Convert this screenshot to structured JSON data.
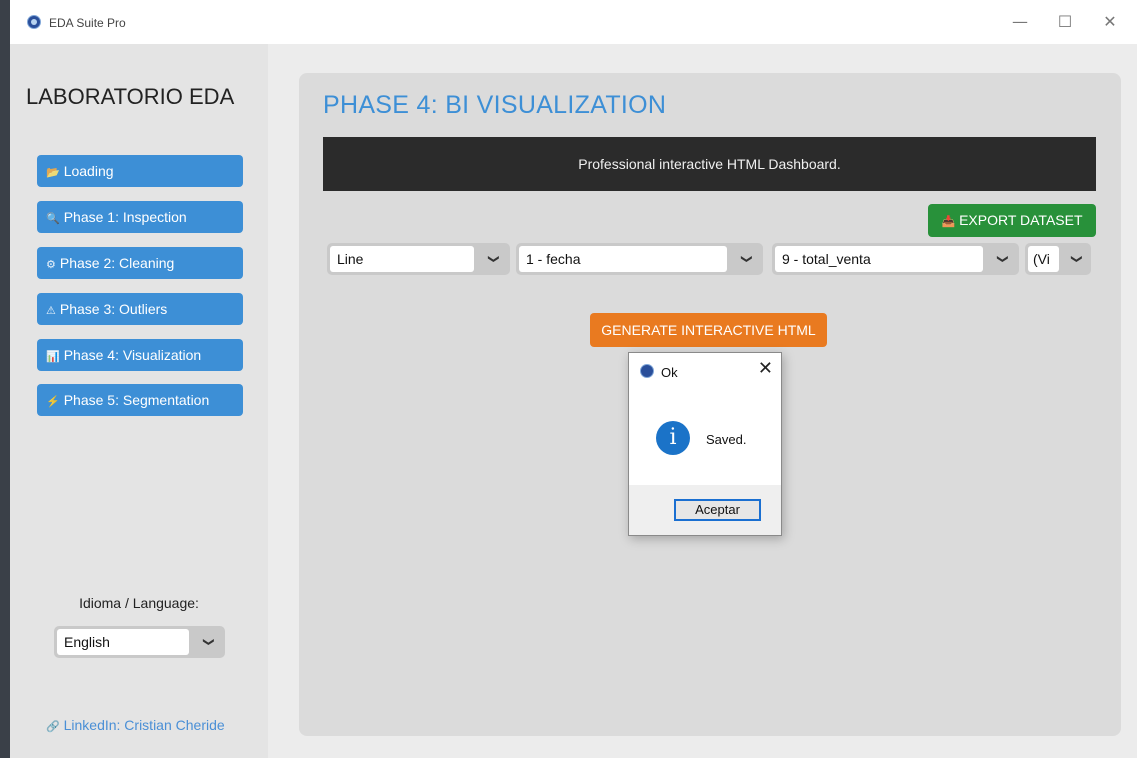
{
  "window": {
    "title": "EDA Suite Pro",
    "minimize_glyph": "—",
    "maximize_glyph": "☐",
    "close_glyph": "✕"
  },
  "sidebar": {
    "brand": "LABORATORIO EDA",
    "items": [
      {
        "icon": "📂",
        "label": "Loading"
      },
      {
        "icon": "🔍",
        "label": "Phase 1: Inspection"
      },
      {
        "icon": "⚙",
        "label": "Phase 2: Cleaning"
      },
      {
        "icon": "⚠",
        "label": "Phase 3: Outliers"
      },
      {
        "icon": "📊",
        "label": "Phase 4: Visualization"
      },
      {
        "icon": "⚡",
        "label": "Phase 5: Segmentation"
      }
    ],
    "language_label": "Idioma / Language:",
    "language_value": "English",
    "linkedin_icon": "🔗",
    "linkedin_text": "LinkedIn: Cristian Cheride"
  },
  "main": {
    "title": "PHASE 4: BI VISUALIZATION",
    "banner": "Professional interactive HTML Dashboard.",
    "export_icon": "📥",
    "export_label": "EXPORT DATASET",
    "chart_type": "Line",
    "x_column": "1 - fecha",
    "y_column": "9 - total_venta",
    "extra_select": "(Vi",
    "generate_label": "GENERATE INTERACTIVE HTML"
  },
  "dialog": {
    "title": "Ok",
    "close_glyph": "✕",
    "info_glyph": "i",
    "message": "Saved.",
    "ok_label": "Aceptar"
  },
  "icons": {
    "dropdown_arrow": "❯"
  },
  "colors": {
    "accent_blue": "#3d8fd6",
    "export_green": "#28913a",
    "generate_orange": "#e97a20",
    "banner_dark": "#2b2b2b"
  }
}
